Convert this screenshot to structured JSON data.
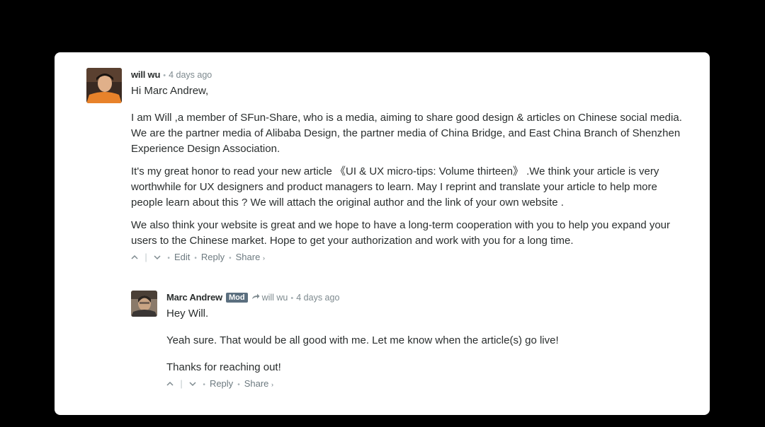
{
  "comments": [
    {
      "author": "will wu",
      "time": "4 days ago",
      "paragraphs": [
        "Hi Marc Andrew,",
        "I am Will ,a member of SFun-Share, who is a media, aiming to share good design & articles on Chinese social media. We are the partner media of Alibaba Design, the partner media of China Bridge, and East China Branch of Shenzhen Experience Design Association.",
        "It's my great honor to read your new article 《UI & UX micro-tips: Volume thirteen》 .We think your article is very worthwhile for UX designers and product managers to learn. May I reprint and translate your article to help more people learn about this ? We will attach the original author and the link of your own website .",
        "We also think your website is great and we hope to have a long-term cooperation with you to help you expand your users to the Chinese market. Hope to get your authorization and work with you for a long time."
      ],
      "actions": {
        "edit": "Edit",
        "reply": "Reply",
        "share": "Share"
      }
    },
    {
      "author": "Marc Andrew",
      "badge": "Mod",
      "reply_to": "will wu",
      "time": "4 days ago",
      "paragraphs": [
        "Hey Will.",
        "Yeah sure. That would be all good with me. Let me know when the article(s) go live!",
        "Thanks for reaching out!"
      ],
      "actions": {
        "reply": "Reply",
        "share": "Share"
      }
    }
  ],
  "icons": {
    "upvote": "^",
    "downvote": "v",
    "reply_arrow": "arrow-icon",
    "share_caret": "›"
  }
}
